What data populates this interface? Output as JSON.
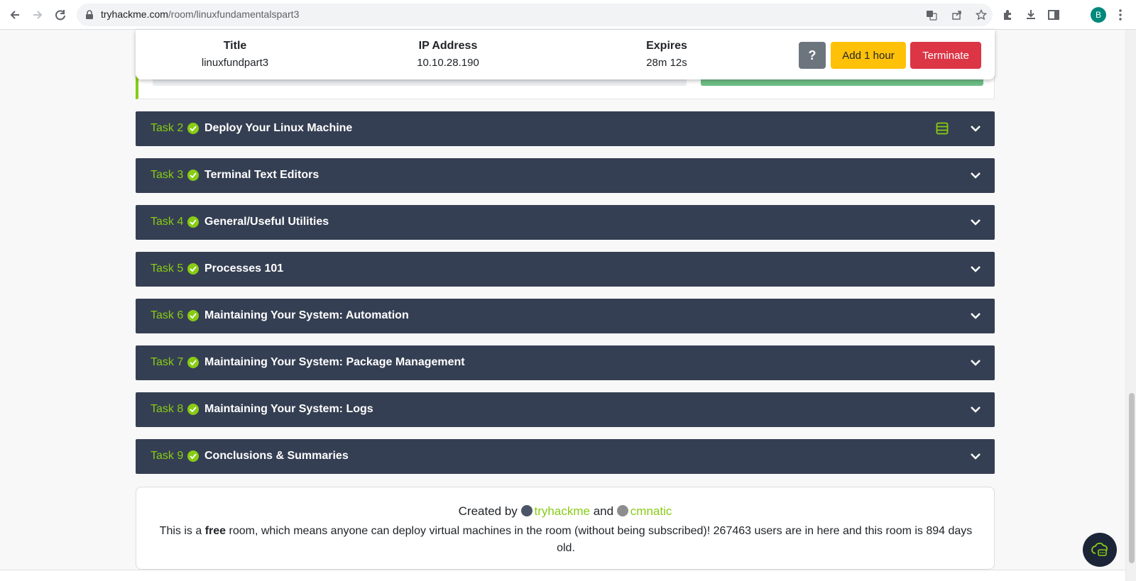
{
  "browser": {
    "url_domain": "tryhackme.com",
    "url_path": "/room/linuxfundamentalspart3",
    "profile_initial": "B"
  },
  "machine": {
    "title_label": "Title",
    "title_value": "linuxfundpart3",
    "ip_label": "IP Address",
    "ip_value": "10.10.28.190",
    "expires_label": "Expires",
    "expires_value": "28m 12s",
    "help_label": "?",
    "add_hour_label": "Add 1 hour",
    "terminate_label": "Terminate"
  },
  "tasks": [
    {
      "num": "Task 2",
      "title": "Deploy Your Linux Machine",
      "has_sheet_icon": true
    },
    {
      "num": "Task 3",
      "title": "Terminal Text Editors"
    },
    {
      "num": "Task 4",
      "title": "General/Useful Utilities"
    },
    {
      "num": "Task 5",
      "title": "Processes 101"
    },
    {
      "num": "Task 6",
      "title": "Maintaining Your System: Automation"
    },
    {
      "num": "Task 7",
      "title": "Maintaining Your System: Package Management"
    },
    {
      "num": "Task 8",
      "title": "Maintaining Your System: Logs"
    },
    {
      "num": "Task 9",
      "title": "Conclusions & Summaries"
    }
  ],
  "footer": {
    "created_by": "Created by",
    "author1": "tryhackme",
    "and": "and",
    "author2": "cmnatic",
    "desc_pre": "This is a",
    "desc_free": "free",
    "desc_post": "room, which means anyone can deploy virtual machines in the room (without being subscribed)! 267463 users are in here and this room is 894 days old."
  },
  "colors": {
    "accent": "#88cc14",
    "task_bg": "#353f53",
    "add_btn": "#ffc107",
    "terminate_btn": "#dc3545",
    "help_btn": "#6c757d"
  }
}
